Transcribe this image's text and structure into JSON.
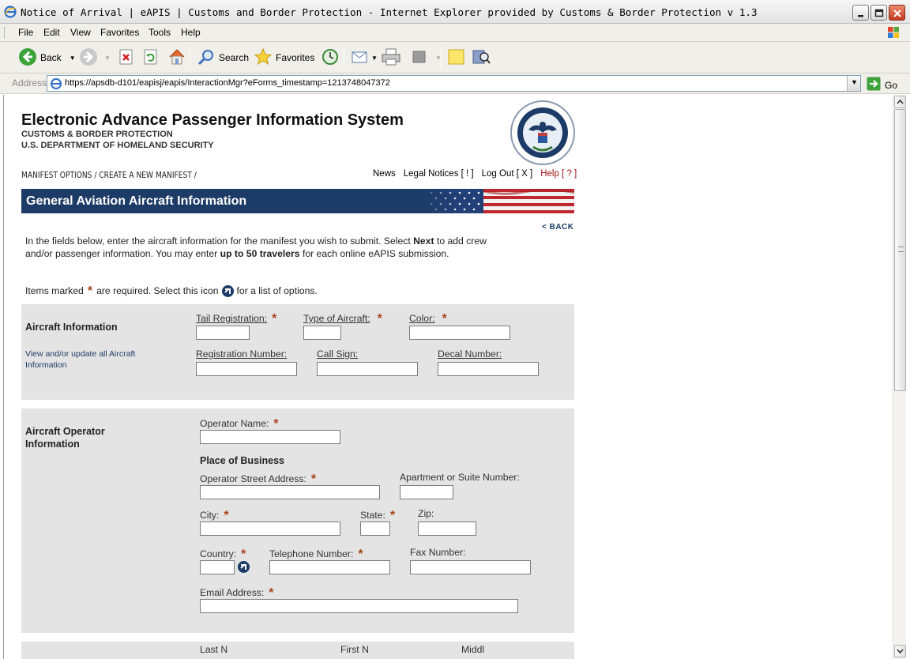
{
  "window": {
    "title": "Notice of Arrival | eAPIS | Customs and Border Protection - Internet Explorer provided by Customs & Border Protection v 1.3"
  },
  "menu": [
    "File",
    "Edit",
    "View",
    "Favorites",
    "Tools",
    "Help"
  ],
  "toolbar": {
    "back": "Back",
    "search": "Search",
    "favorites": "Favorites"
  },
  "address": {
    "label": "Address",
    "url": "https://apsdb-d101/eapisj/eapis/InteractionMgr?eForms_timestamp=1213748047372",
    "go": "Go"
  },
  "header": {
    "title": "Electronic Advance Passenger Information System",
    "agency1": "CUSTOMS & BORDER PROTECTION",
    "agency2": "U.S. DEPARTMENT OF HOMELAND SECURITY",
    "breadcrumb": "MANIFEST OPTIONS / CREATE A NEW MANIFEST /",
    "nav": {
      "news": "News",
      "legal": "Legal Notices [ ! ]",
      "logout": "Log Out [ X ]",
      "help": "Help [ ? ]"
    }
  },
  "banner": {
    "title": "General Aviation Aircraft Information"
  },
  "back_link": "< BACK",
  "intro": {
    "p1": "In the fields below, enter the aircraft information for the manifest you wish to submit. Select ",
    "next": "Next",
    "p2": " to add crew and/or passenger information. You may enter ",
    "limit": "up to 50 travelers",
    "p3": " for each online eAPIS submission."
  },
  "required_note": {
    "before": "Items marked",
    "middle": "are required. Select this icon",
    "after": "for a list of options."
  },
  "aircraft": {
    "title": "Aircraft Information",
    "link": "View and/or update all Aircraft Information",
    "tail_registration": "Tail Registration:",
    "type_of_aircraft": "Type of Aircraft:",
    "color": "Color:",
    "registration_number": "Registration Number:",
    "call_sign": "Call Sign:",
    "decal_number": "Decal Number:"
  },
  "operator": {
    "title": "Aircraft Operator Information",
    "operator_name": "Operator Name:",
    "place_of_business": "Place of Business",
    "street": "Operator Street Address:",
    "apartment": "Apartment or Suite Number:",
    "city": "City:",
    "state": "State:",
    "zip": "Zip:",
    "country": "Country:",
    "telephone": "Telephone Number:",
    "fax": "Fax Number:",
    "email": "Email Address:"
  },
  "next_section_labels": {
    "last": "Last N",
    "first": "First N",
    "middle": "Middl"
  },
  "colors": {
    "banner": "#1c3b66",
    "section_bg": "#e4e4e4",
    "required_star": "#a8441c",
    "help": "#a01010"
  },
  "required_symbol": "*"
}
